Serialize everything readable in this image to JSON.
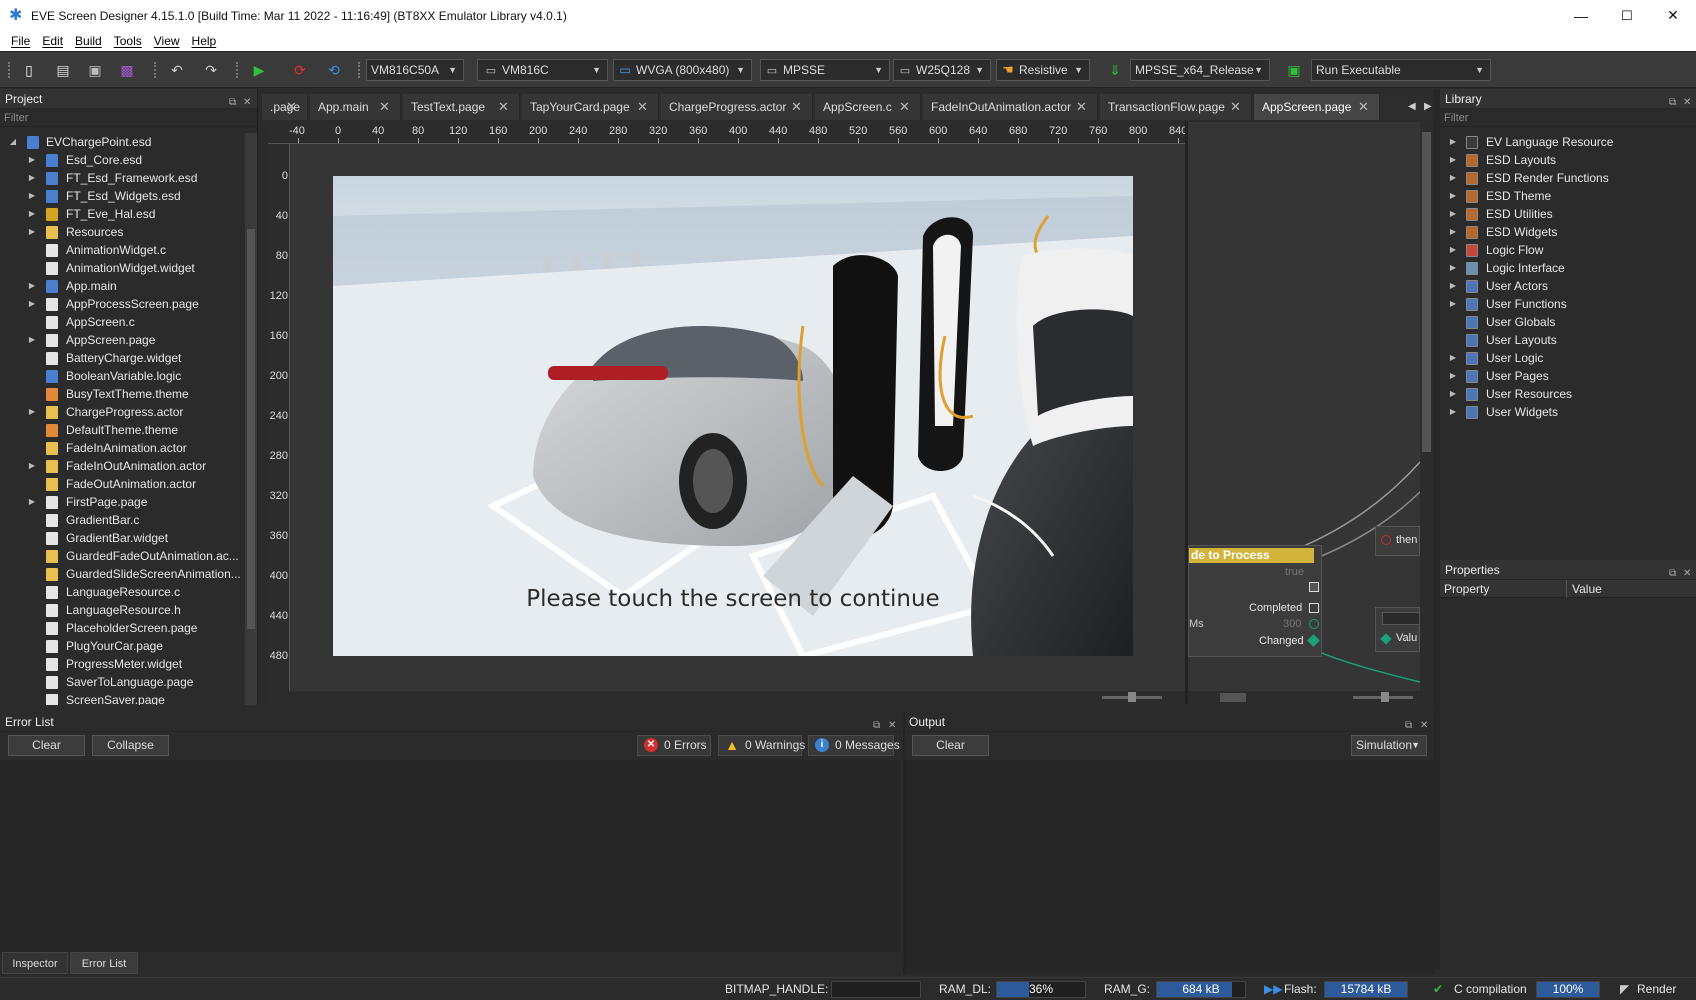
{
  "window": {
    "title": "EVE Screen Designer 4.15.1.0  [Build Time: Mar 11 2022 - 11:16:49]  (BT8XX Emulator Library v4.0.1)",
    "minimize": "—",
    "maximize": "☐",
    "close": "✕"
  },
  "menu": [
    "File",
    "Edit",
    "Build",
    "Tools",
    "View",
    "Help"
  ],
  "toolbar": {
    "board": "VM816C50A",
    "chip": "VM816C",
    "resolution": "WVGA (800x480)",
    "connection": "MPSSE",
    "flash": "W25Q128",
    "touch": "Resistive",
    "build_config": "MPSSE_x64_Release",
    "run": "Run Executable"
  },
  "project": {
    "title": "Project",
    "filter_placeholder": "Filter",
    "root": "EVChargePoint.esd",
    "items": [
      {
        "label": "Esd_Core.esd",
        "expand": true,
        "icon": "esd"
      },
      {
        "label": "FT_Esd_Framework.esd",
        "expand": true,
        "icon": "esd"
      },
      {
        "label": "FT_Esd_Widgets.esd",
        "expand": true,
        "icon": "esd"
      },
      {
        "label": "FT_Eve_Hal.esd",
        "expand": true,
        "icon": "hal"
      },
      {
        "label": "Resources",
        "expand": true,
        "icon": "folder"
      },
      {
        "label": "AnimationWidget.c",
        "expand": false,
        "icon": "c"
      },
      {
        "label": "AnimationWidget.widget",
        "expand": false,
        "icon": "widget"
      },
      {
        "label": "App.main",
        "expand": true,
        "icon": "main"
      },
      {
        "label": "AppProcessScreen.page",
        "expand": true,
        "icon": "page"
      },
      {
        "label": "AppScreen.c",
        "expand": false,
        "icon": "c"
      },
      {
        "label": "AppScreen.page",
        "expand": true,
        "icon": "page"
      },
      {
        "label": "BatteryCharge.widget",
        "expand": false,
        "icon": "widget"
      },
      {
        "label": "BooleanVariable.logic",
        "expand": false,
        "icon": "logic"
      },
      {
        "label": "BusyTextTheme.theme",
        "expand": false,
        "icon": "theme"
      },
      {
        "label": "ChargeProgress.actor",
        "expand": true,
        "icon": "folder"
      },
      {
        "label": "DefaultTheme.theme",
        "expand": false,
        "icon": "theme"
      },
      {
        "label": "FadeInAnimation.actor",
        "expand": false,
        "icon": "folder"
      },
      {
        "label": "FadeInOutAnimation.actor",
        "expand": true,
        "icon": "folder"
      },
      {
        "label": "FadeOutAnimation.actor",
        "expand": false,
        "icon": "folder"
      },
      {
        "label": "FirstPage.page",
        "expand": true,
        "icon": "page"
      },
      {
        "label": "GradientBar.c",
        "expand": false,
        "icon": "c"
      },
      {
        "label": "GradientBar.widget",
        "expand": false,
        "icon": "widget"
      },
      {
        "label": "GuardedFadeOutAnimation.ac...",
        "expand": false,
        "icon": "folder"
      },
      {
        "label": "GuardedSlideScreenAnimation...",
        "expand": false,
        "icon": "folder"
      },
      {
        "label": "LanguageResource.c",
        "expand": false,
        "icon": "c"
      },
      {
        "label": "LanguageResource.h",
        "expand": false,
        "icon": "c"
      },
      {
        "label": "PlaceholderScreen.page",
        "expand": false,
        "icon": "page"
      },
      {
        "label": "PlugYourCar.page",
        "expand": false,
        "icon": "page"
      },
      {
        "label": "ProgressMeter.widget",
        "expand": false,
        "icon": "widget"
      },
      {
        "label": "SaverToLanguage.page",
        "expand": false,
        "icon": "page"
      },
      {
        "label": "ScreenSaver.page",
        "expand": false,
        "icon": "page"
      }
    ]
  },
  "tabs": [
    {
      "label": ".page"
    },
    {
      "label": "App.main"
    },
    {
      "label": "TestText.page"
    },
    {
      "label": "TapYourCard.page"
    },
    {
      "label": "ChargeProgress.actor"
    },
    {
      "label": "AppScreen.c"
    },
    {
      "label": "FadeInOutAnimation.actor"
    },
    {
      "label": "TransactionFlow.page"
    },
    {
      "label": "AppScreen.page"
    }
  ],
  "ruler": {
    "h": [
      "-40",
      "0",
      "40",
      "80",
      "120",
      "160",
      "200",
      "240",
      "280",
      "320",
      "360",
      "400",
      "440",
      "480",
      "520",
      "560",
      "600",
      "640",
      "680",
      "720",
      "760",
      "800",
      "840"
    ],
    "v": [
      "0",
      "40",
      "80",
      "120",
      "160",
      "200",
      "240",
      "280",
      "320",
      "360",
      "400",
      "440",
      "480"
    ]
  },
  "screen": {
    "caption": "Please touch the screen to continue"
  },
  "nodes": {
    "node_title": "de to Process",
    "true_label": "true",
    "completed": "Completed",
    "ms": "Ms",
    "ms_value": "300",
    "changed": "Changed",
    "then": "then",
    "value": "Valu"
  },
  "library": {
    "title": "Library",
    "filter_placeholder": "Filter",
    "items": [
      {
        "label": "EV Language Resource",
        "color": "#3a3a3a"
      },
      {
        "label": "ESD Layouts",
        "color": "#b8692e"
      },
      {
        "label": "ESD Render Functions",
        "color": "#b8692e"
      },
      {
        "label": "ESD Theme",
        "color": "#b8692e"
      },
      {
        "label": "ESD Utilities",
        "color": "#b8692e"
      },
      {
        "label": "ESD Widgets",
        "color": "#b8692e"
      },
      {
        "label": "Logic Flow",
        "color": "#c8463a"
      },
      {
        "label": "Logic Interface",
        "color": "#6a8fb5"
      },
      {
        "label": "User Actors",
        "color": "#4d76b8"
      },
      {
        "label": "User Functions",
        "color": "#4d76b8"
      },
      {
        "label": "User Globals",
        "color": "#4d76b8"
      },
      {
        "label": "User Layouts",
        "color": "#4d76b8"
      },
      {
        "label": "User Logic",
        "color": "#4d76b8"
      },
      {
        "label": "User Pages",
        "color": "#4d76b8"
      },
      {
        "label": "User Resources",
        "color": "#4d76b8"
      },
      {
        "label": "User Widgets",
        "color": "#4d76b8"
      }
    ]
  },
  "properties": {
    "title": "Properties",
    "col_property": "Property",
    "col_value": "Value"
  },
  "errorlist": {
    "title": "Error List",
    "clear": "Clear",
    "collapse": "Collapse",
    "errors": "0 Errors",
    "warnings": "0 Warnings",
    "messages": "0 Messages"
  },
  "output": {
    "title": "Output",
    "clear": "Clear",
    "mode": "Simulation"
  },
  "bottom_tabs": [
    "Inspector",
    "Error List"
  ],
  "status": {
    "bitmap_label": "BITMAP_HANDLE:",
    "bitmap_value": "",
    "ram_dl_label": "RAM_DL:",
    "ram_dl_value": "36%",
    "ram_dl_fraction": 0.36,
    "ram_g_label": "RAM_G:",
    "ram_g_value": "684 kB",
    "ram_g_fraction": 0.85,
    "flash_label": "Flash:",
    "flash_value": "15784 kB",
    "flash_fraction": 1.0,
    "compile_label": "C compilation",
    "compile_value": "100%",
    "compile_fraction": 1.0,
    "render_label": "Render"
  }
}
